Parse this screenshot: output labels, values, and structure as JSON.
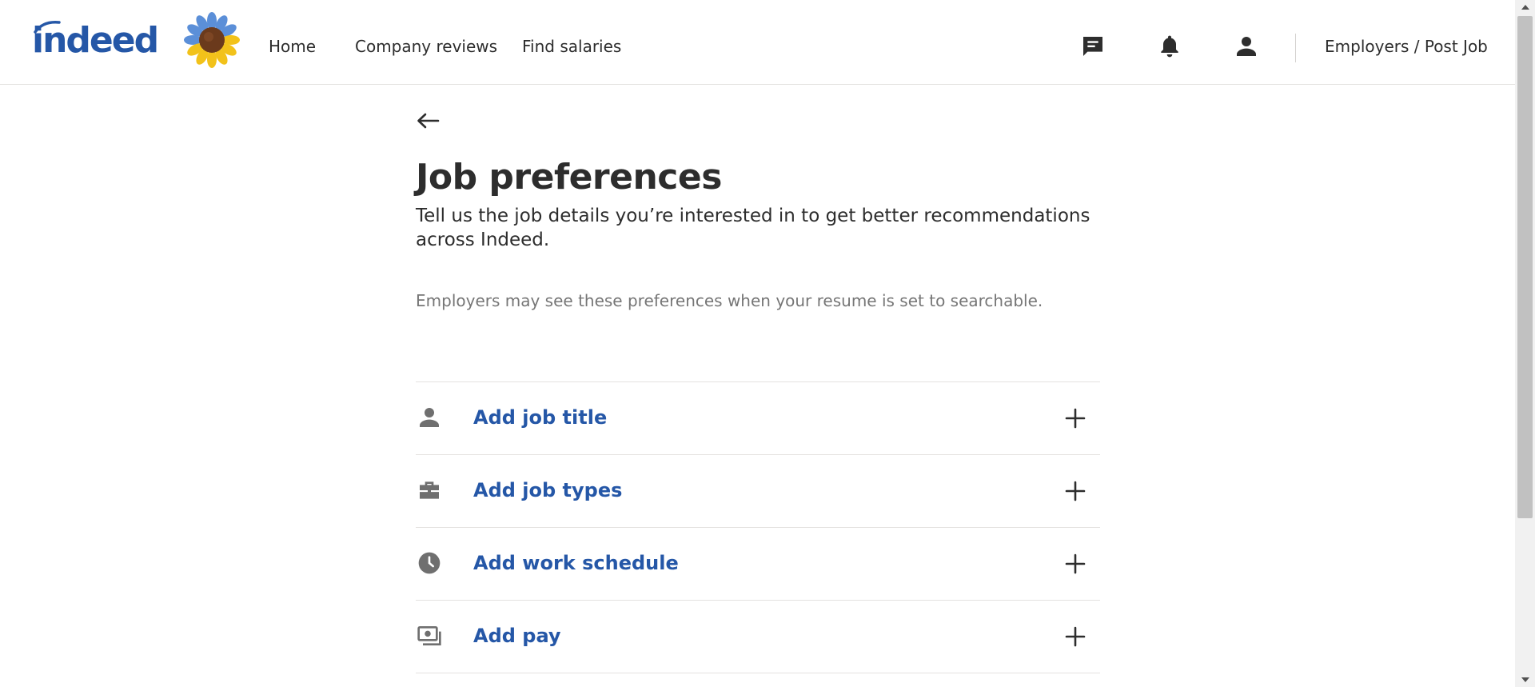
{
  "header": {
    "logo_text": "indeed",
    "nav": {
      "home": "Home",
      "company_reviews": "Company reviews",
      "find_salaries": "Find salaries"
    },
    "employers_link": "Employers / Post Job",
    "icons": [
      "messages-icon",
      "notifications-bell-icon",
      "account-person-icon"
    ]
  },
  "main": {
    "title": "Job preferences",
    "subtitle": "Tell us the job details you’re interested in to get better recommendations across Indeed.",
    "note": "Employers may see these preferences when your resume is set to searchable.",
    "preferences": [
      {
        "label": "Add job title",
        "icon": "person-icon"
      },
      {
        "label": "Add job types",
        "icon": "briefcase-icon"
      },
      {
        "label": "Add work schedule",
        "icon": "clock-icon"
      },
      {
        "label": "Add pay",
        "icon": "money-icon"
      }
    ]
  },
  "colors": {
    "brand_blue": "#2557a7",
    "text": "#2d2d2d",
    "muted": "#767676",
    "icon_gray": "#6f6f6f",
    "divider": "#e4e2e0"
  }
}
